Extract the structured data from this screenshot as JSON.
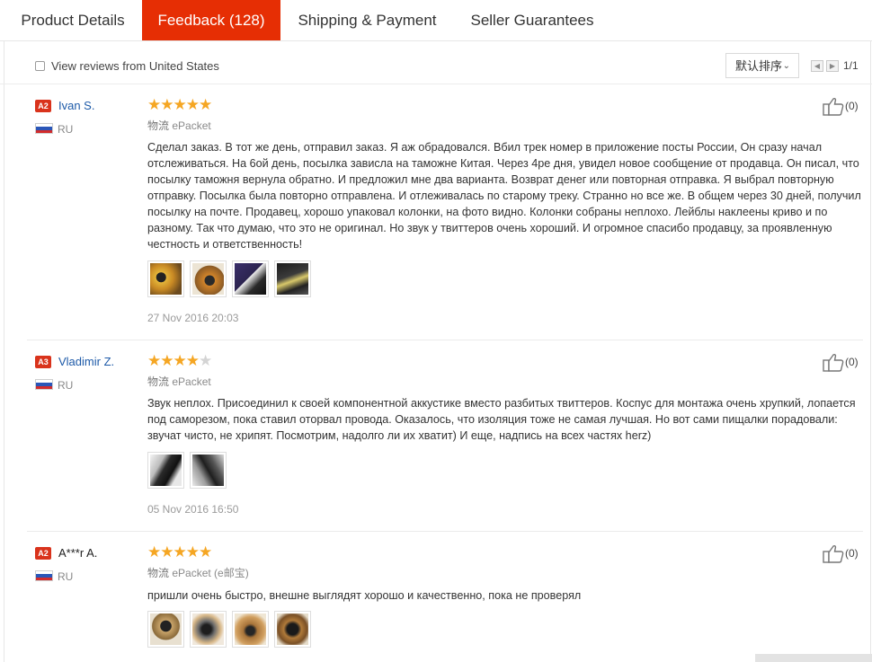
{
  "tabs": [
    {
      "label": "Product Details",
      "active": false
    },
    {
      "label": "Feedback (128)",
      "active": true
    },
    {
      "label": "Shipping & Payment",
      "active": false
    },
    {
      "label": "Seller Guarantees",
      "active": false
    }
  ],
  "filter": {
    "checkbox_label": "View reviews from United States",
    "checked": false,
    "sort_label": "默认排序",
    "page_indicator": "1/1"
  },
  "colors": {
    "accent": "#e62e04",
    "star": "#f5a623",
    "link": "#1d5aa8",
    "badge": "#d9331c"
  },
  "reviews": [
    {
      "badge": "A2",
      "name": "Ivan S.",
      "country": "RU",
      "rating": 5,
      "logistics_label": "物流",
      "logistics_value": "ePacket",
      "text": "Сделал заказ. В тот же день, отправил заказ. Я аж обрадовался. Вбил трек номер в приложение посты России, Он сразу начал отслеживаться. На 6ой день, посылка зависла на таможне Китая. Через 4ре дня, увидел новое сообщение от продавца. Он писал, что посылку таможня вернула обратно. И предложил мне два варианта. Возврат денег или повторная отправка. Я выбрал повторную отправку. Посылка была повторно отправлена. И отлеживалась по старому треку. Странно но все же. В общем через 30 дней, получил посылку на почте. Продавец, хорошо упаковал колонки, на фото видно. Колонки собраны неплохо. Лейблы наклеены криво и по разному. Так что думаю, что это не оригинал. Но звук у твиттеров очень хороший. И огромное спасибо продавцу, за проявленную честность и ответственность!",
      "photos": 4,
      "date": "27 Nov 2016 20:03",
      "likes": "(0)"
    },
    {
      "badge": "A3",
      "name": "Vladimir Z.",
      "country": "RU",
      "rating": 4,
      "logistics_label": "物流",
      "logistics_value": "ePacket",
      "text": "Звук неплох. Присоединил к своей компонентной аккустике вместо разбитых твиттеров. Коспус для монтажа очень хрупкий, лопается под саморезом, пока ставил оторвал провода. Оказалось, что изоляция тоже не самая лучшая. Но вот сами пищалки порадовали: звучат чисто, не хрипят. Посмотрим, надолго ли их хватит) И еще, надпись на всех частях herz)",
      "photos": 2,
      "date": "05 Nov 2016 16:50",
      "likes": "(0)"
    },
    {
      "badge": "A2",
      "name": "A***r A.",
      "country": "RU",
      "rating": 5,
      "logistics_label": "物流",
      "logistics_value": "ePacket (e邮宝)",
      "text": "пришли очень быстро, внешне выглядят хорошо и качественно, пока не проверял",
      "photos": 4,
      "date": "",
      "likes": "(0)"
    }
  ]
}
